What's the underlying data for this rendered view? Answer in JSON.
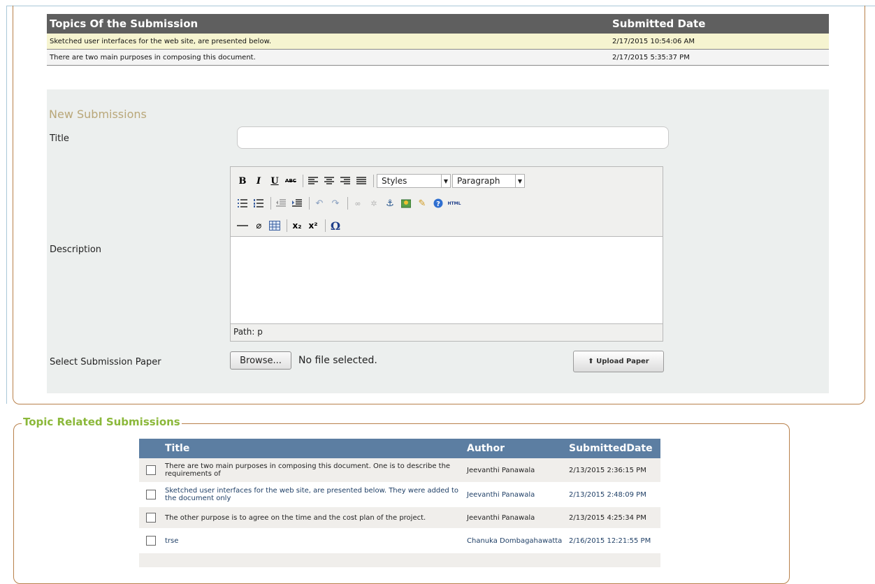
{
  "topics_table": {
    "headers": [
      "Topics Of the Submission",
      "Submitted Date"
    ],
    "rows": [
      {
        "topic": "Sketched user interfaces for the web site, are presented below.",
        "date": "2/17/2015 10:54:06 AM"
      },
      {
        "topic": "There are two main purposes in composing this document.",
        "date": "2/17/2015 5:35:37 PM"
      }
    ]
  },
  "new_submission": {
    "heading": "New Submissions",
    "title_label": "Title",
    "title_value": "",
    "description_label": "Description",
    "editor": {
      "bold": "B",
      "italic": "I",
      "underline": "U",
      "strike": "ABC",
      "styles_select": "Styles",
      "format_select": "Paragraph",
      "html_label": "HTML",
      "subscript": "x₂",
      "superscript": "x²",
      "omega": "Ω",
      "path_text": "Path: p"
    },
    "paper_label": "Select Submission Paper",
    "browse_label": "Browse...",
    "no_file_text": "No file selected.",
    "upload_label": "⬆ Upload Paper"
  },
  "related": {
    "legend": "Topic Related Submissions",
    "headers": [
      "Title",
      "Author",
      "SubmittedDate"
    ],
    "rows": [
      {
        "title": "There are two main purposes in composing this document. One is to describe the requirements of",
        "author": "Jeevanthi Panawala",
        "date": "2/13/2015 2:36:15 PM"
      },
      {
        "title": "Sketched user interfaces for the web site, are presented below. They were added to the document only",
        "author": "Jeevanthi Panawala",
        "date": "2/13/2015 2:48:09 PM"
      },
      {
        "title": "The other purpose is to agree on the time and the cost plan of the project.",
        "author": "Jeevanthi Panawala",
        "date": "2/13/2015 4:25:34 PM"
      },
      {
        "title": "trse",
        "author": "Chanuka Dombagahawatta",
        "date": "2/16/2015 12:21:55 PM"
      }
    ]
  },
  "colors": {
    "topics_header": "#5f5f5f",
    "highlight_row": "#f6f4d0",
    "related_header": "#5c7ea2",
    "legend_green": "#8bb83a",
    "frame_brown": "#b8804a"
  }
}
